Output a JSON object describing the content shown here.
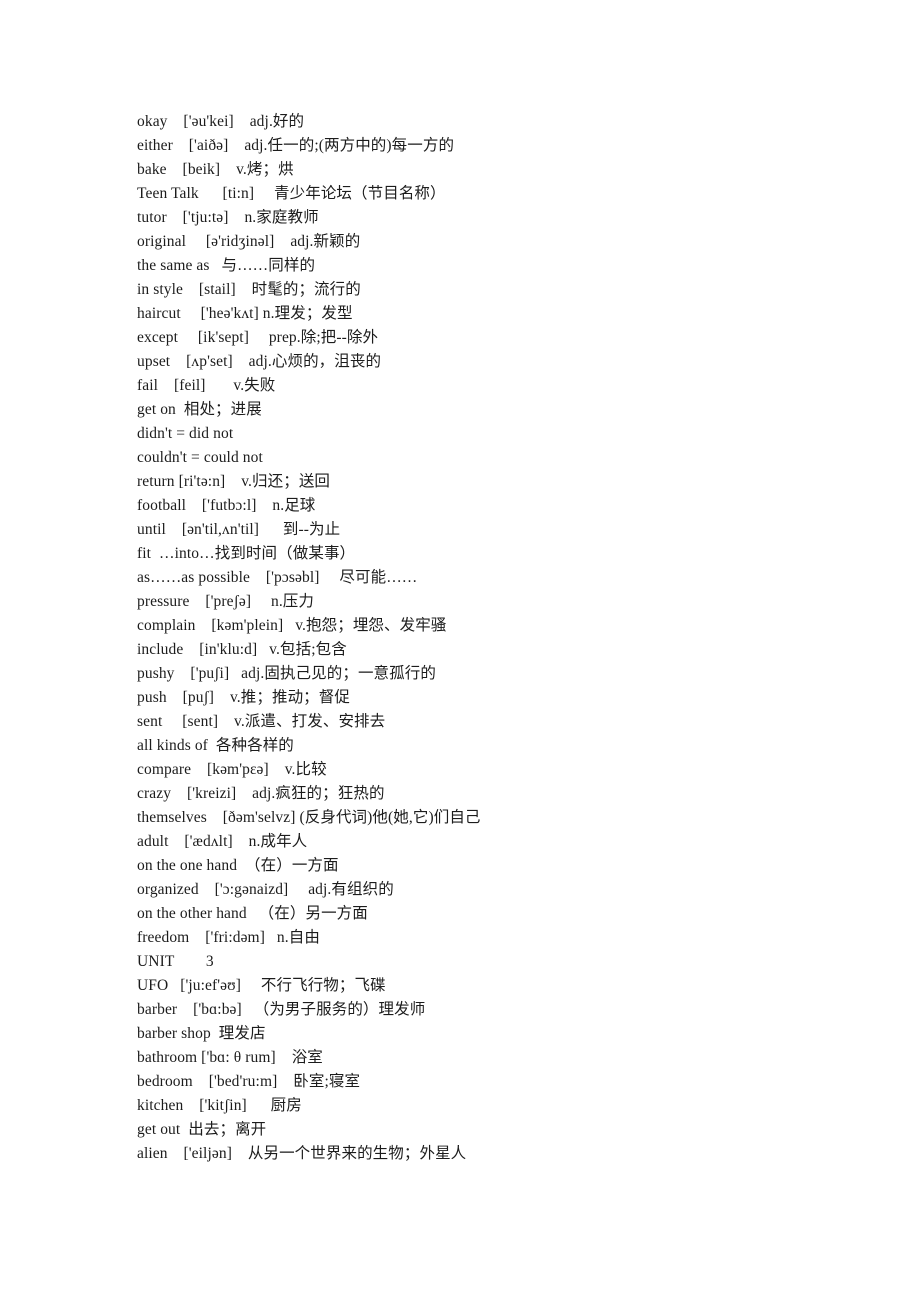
{
  "document": {
    "kind": "vocabulary-word-list",
    "page_background": "#ffffff",
    "text_color": "#1c1c1c",
    "entries": [
      "okay    ['əu'kei]    adj.好的",
      "either    ['aiðə]    adj.任一的;(两方中的)每一方的",
      "bake    [beik]    v.烤；烘",
      "Teen Talk      [ti:n]     青少年论坛（节目名称）",
      "tutor    ['tju:tə]    n.家庭教师",
      "original     [ə'ridʒinəl]    adj.新颖的",
      "the same as   与……同样的",
      "in style    [stail]    时髦的；流行的",
      "haircut     ['heə'kʌt] n.理发；发型",
      "except     [ik'sept]     prep.除;把--除外",
      "upset    [ʌp'set]    adj.心烦的，沮丧的",
      "fail    [feil]       v.失败",
      "get on  相处；进展",
      "didn't = did not",
      "couldn't = could not",
      "return [ri'tə:n]    v.归还；送回",
      "football    ['futbɔ:l]    n.足球",
      "until    [ən'til,ʌn'til]      到--为止",
      "fit  …into…找到时间（做某事）",
      "as……as possible    ['pɔsəbl]     尽可能……",
      "pressure    ['preʃə]     n.压力",
      "complain    [kəm'plein]   v.抱怨；埋怨、发牢骚",
      "include    [in'klu:d]   v.包括;包含",
      "pushy    ['puʃi]   adj.固执己见的；一意孤行的",
      "push    [puʃ]    v.推；推动；督促",
      "sent     [sent]    v.派遣、打发、安排去",
      "all kinds of  各种各样的",
      "compare    [kəm'pɛə]    v.比较",
      "crazy    ['kreizi]    adj.疯狂的；狂热的",
      "themselves    [ðəm'selvz] (反身代词)他(她,它)们自己",
      "adult    ['ædʌlt]    n.成年人",
      "on the one hand  （在）一方面",
      "organized    ['ɔ:gənaizd]     adj.有组织的",
      "on the other hand   （在）另一方面",
      "freedom    ['fri:dəm]   n.自由",
      "UNIT        3",
      "UFO   ['ju:ef'əʊ]     不行飞行物；飞碟",
      "barber    ['bɑ:bə]   （为男子服务的）理发师",
      "barber shop  理发店",
      "bathroom ['bɑ: θ rum]    浴室",
      "bedroom    ['bed'ru:m]    卧室;寝室",
      "kitchen    ['kitʃin]      厨房",
      "get out  出去；离开",
      "alien    ['eiljən]    从另一个世界来的生物；外星人"
    ]
  }
}
